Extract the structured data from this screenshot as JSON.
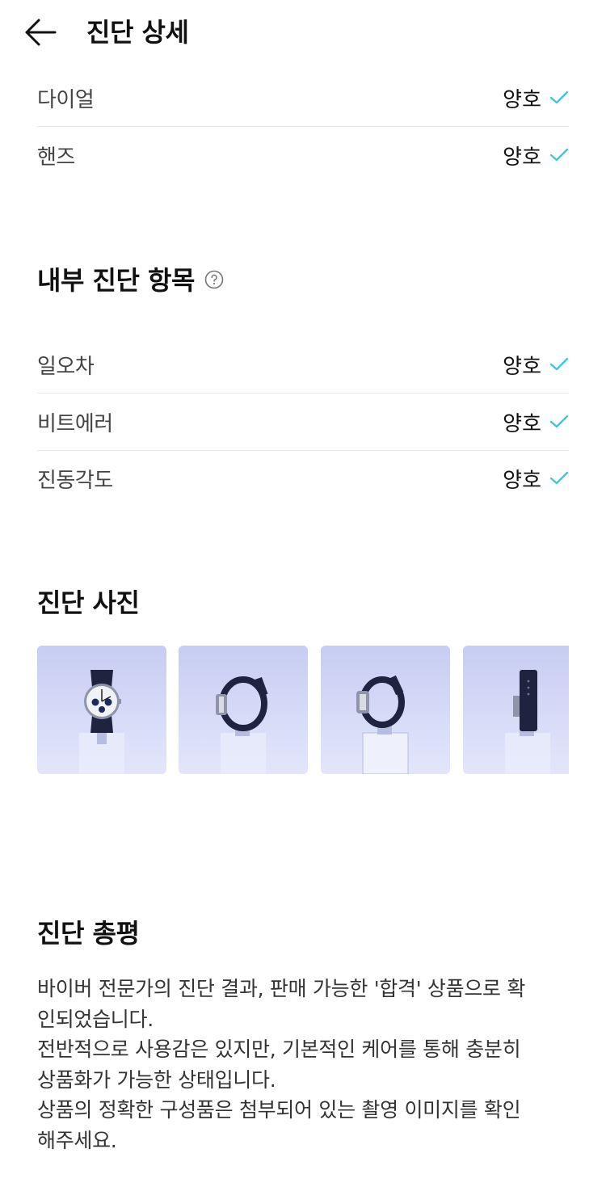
{
  "header": {
    "title": "진단 상세"
  },
  "exterior_items": [
    {
      "label": "다이얼",
      "status": "양호"
    },
    {
      "label": "핸즈",
      "status": "양호"
    }
  ],
  "internal_section": {
    "title": "내부 진단 항목",
    "items": [
      {
        "label": "일오차",
        "status": "양호"
      },
      {
        "label": "비트에러",
        "status": "양호"
      },
      {
        "label": "진동각도",
        "status": "양호"
      }
    ]
  },
  "photos_section": {
    "title": "진단 사진",
    "photos": [
      "watch-front-photo",
      "watch-side-left-photo",
      "watch-side-right-photo",
      "watch-back-strap-photo"
    ]
  },
  "summary_section": {
    "title": "진단 총평",
    "lines": [
      "바이버 전문가의 진단 결과, 판매 가능한 '합격' 상품으로 확",
      "인되었습니다.",
      "전반적으로 사용감은 있지만, 기본적인 케어를 통해 충분히",
      "상품화가 가능한 상태입니다.",
      "상품의 정확한 구성품은 첨부되어 있는 촬영 이미지를 확인",
      "해주세요."
    ]
  },
  "colors": {
    "check": "#3cc8d8",
    "divider": "#e9e9e9",
    "photo_bg": "#d3d8f5"
  }
}
